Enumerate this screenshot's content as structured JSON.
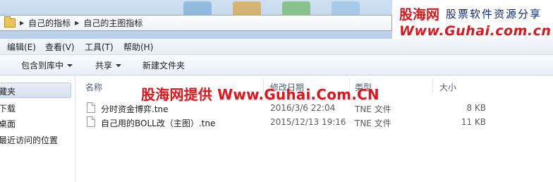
{
  "address_bar": {
    "crumbs": [
      "自己的指标",
      "自己的主图指标"
    ]
  },
  "watermark_badge": {
    "logo": "股海网",
    "tagline": "股票软件资源分享",
    "url": "Www.Guhai.com.cn"
  },
  "menu": {
    "items": [
      "编辑(E)",
      "查看(V)",
      "工具(T)",
      "帮助(H)"
    ]
  },
  "toolbar": {
    "include_library": "包含到库中",
    "share": "共享",
    "new_folder": "新建文件夹"
  },
  "nav": {
    "items": [
      "藏夹",
      "下载",
      "桌面",
      "最近访问的位置"
    ]
  },
  "columns": {
    "name": "名称",
    "date": "修改日期",
    "type": "类型",
    "size": "大小"
  },
  "files": [
    {
      "name": "分时资金博弈.tne",
      "date": "2016/3/6 22:04",
      "type": "TNE 文件",
      "size": "8 KB"
    },
    {
      "name": "自己用的BOLL改（主图）.tne",
      "date": "2015/12/13 19:16",
      "type": "TNE 文件",
      "size": "11 KB"
    }
  ],
  "overlay_watermark": "股海网提供 Www.Guhai.Com.CN",
  "colors": {
    "watermark_red": "#e3141b",
    "badge_navy": "#0d2b73",
    "title_blue": "#cfe0f2"
  }
}
